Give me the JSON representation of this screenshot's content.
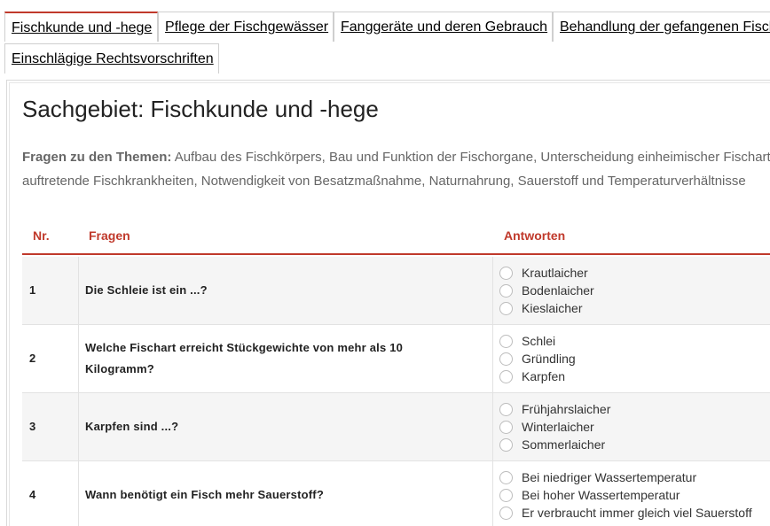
{
  "tabs": [
    {
      "label": "Fischkunde und -hege",
      "active": true
    },
    {
      "label": "Pflege der Fischgewässer",
      "active": false
    },
    {
      "label": "Fanggeräte und deren Gebrauch",
      "active": false
    },
    {
      "label": "Behandlung der gefangenen Fische",
      "active": false
    },
    {
      "label": "Einschlägige Rechtsvorschriften",
      "active": false
    }
  ],
  "heading": "Sachgebiet: Fischkunde und -hege",
  "topics": {
    "label": "Fragen zu den Themen:",
    "line1": "Aufbau des Fischkörpers, Bau und Funktion der Fischorgane, Unterscheidung einheimischer Fischarten,",
    "line2": "auftretende Fischkrankheiten, Notwendigkeit von Besatzmaßnahme, Naturnahrung, Sauerstoff und Temperaturverhältnisse"
  },
  "table": {
    "headers": {
      "nr": "Nr.",
      "question": "Fragen",
      "answers": "Antworten"
    },
    "rows": [
      {
        "nr": "1",
        "question": "Die Schleie ist ein ...?",
        "answers": [
          "Krautlaicher",
          "Bodenlaicher",
          "Kieslaicher"
        ]
      },
      {
        "nr": "2",
        "question": "Welche Fischart erreicht Stückgewichte von mehr als 10 Kilogramm?",
        "answers": [
          "Schlei",
          "Gründling",
          "Karpfen"
        ]
      },
      {
        "nr": "3",
        "question": "Karpfen sind ...?",
        "answers": [
          "Frühjahrslaicher",
          "Winterlaicher",
          "Sommerlaicher"
        ]
      },
      {
        "nr": "4",
        "question": "Wann benötigt ein Fisch mehr Sauerstoff?",
        "answers": [
          "Bei niedriger Wassertemperatur",
          "Bei hoher Wassertemperatur",
          "Er verbraucht immer gleich viel Sauerstoff"
        ]
      }
    ]
  },
  "colors": {
    "accent": "#c0392b"
  }
}
